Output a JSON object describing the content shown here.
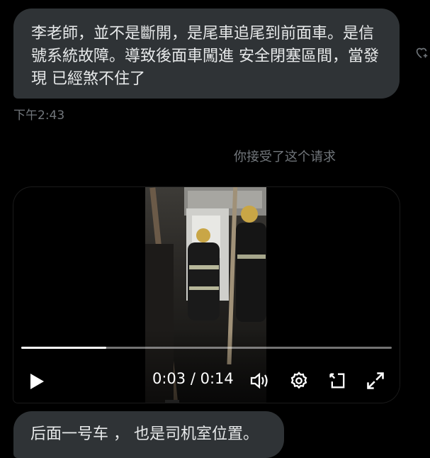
{
  "messages": [
    {
      "text": "李老師，並不是斷開，是尾車追尾到前面車。是信號系統故障。導致後面車闖進 安全閉塞區間，當發現 已經煞不住了",
      "time": "下午2:43"
    },
    {
      "text": "后面一号车 ， 也是司机室位置。"
    }
  ],
  "system_note": "你接受了这个请求",
  "video": {
    "current_time": "0:03",
    "duration": "0:14",
    "separator": "/",
    "progress_fraction": 0.23
  },
  "icons": {
    "react": "heart-plus-icon",
    "play": "play-icon",
    "volume": "volume-icon",
    "settings": "gear-icon",
    "pip": "picture-in-picture-icon",
    "fullscreen": "expand-icon"
  },
  "colors": {
    "background": "#000000",
    "bubble": "#2f3336",
    "text": "#e7e9ea",
    "muted": "#71767b"
  }
}
